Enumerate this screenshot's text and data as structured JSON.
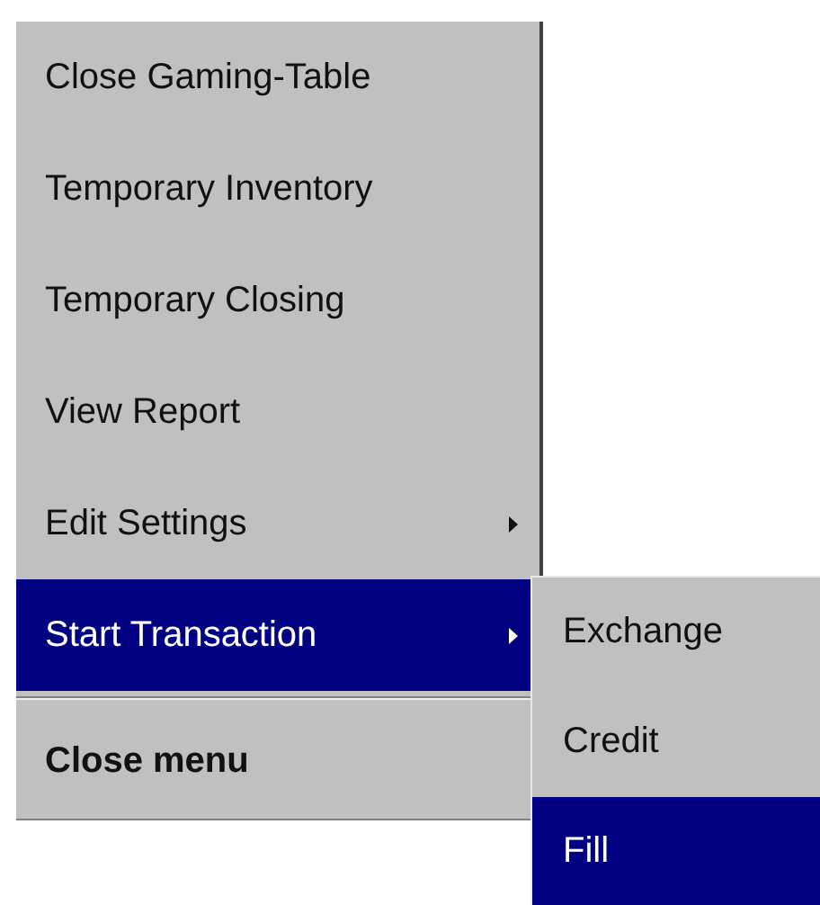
{
  "menu": {
    "items": [
      {
        "kind": "item",
        "label": "Close Gaming-Table",
        "selected": false,
        "has_submenu": false
      },
      {
        "kind": "item",
        "label": "Temporary Inventory",
        "selected": false,
        "has_submenu": false
      },
      {
        "kind": "item",
        "label": "Temporary Closing",
        "selected": false,
        "has_submenu": false
      },
      {
        "kind": "item",
        "label": "View Report",
        "selected": false,
        "has_submenu": false
      },
      {
        "kind": "item",
        "label": "Edit Settings",
        "selected": false,
        "has_submenu": true
      },
      {
        "kind": "item",
        "label": "Start Transaction",
        "selected": true,
        "has_submenu": true
      },
      {
        "kind": "separator"
      },
      {
        "kind": "close",
        "label": "Close menu",
        "selected": false,
        "has_submenu": false
      }
    ]
  },
  "submenu": {
    "items": [
      {
        "label": "Exchange",
        "selected": false
      },
      {
        "label": "Credit",
        "selected": false
      },
      {
        "label": "Fill",
        "selected": true
      }
    ]
  }
}
